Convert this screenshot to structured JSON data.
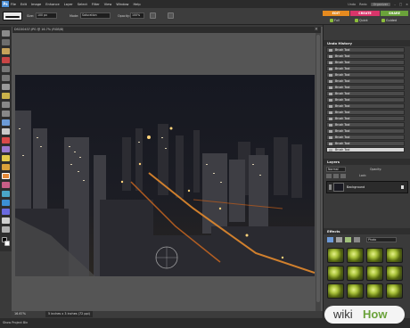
{
  "menubar": {
    "menus": [
      "File",
      "Edit",
      "Image",
      "Enhance",
      "Layer",
      "Select",
      "Filter",
      "View",
      "Window",
      "Help"
    ],
    "right": [
      "Undo",
      "Redo",
      "Organizer"
    ]
  },
  "options": {
    "size_label": "Size:",
    "size_value": "100 px",
    "mode_label": "Mode:",
    "mode_value": "Saturation",
    "opacity_label": "Opacity:",
    "opacity_value": "100%"
  },
  "modes": {
    "edit": "EDIT",
    "create": "CREATE",
    "share": "SHARE",
    "sub": [
      "Full",
      "Quick",
      "Guided"
    ]
  },
  "document": {
    "title": "DSC00437.JPG @ 16.7% (RGB/8)",
    "zoom": "16.67%",
    "dims": "5 inches x 3 inches (72 ppi)"
  },
  "undo_history": {
    "title": "Undo History",
    "items": [
      "Brush Tool",
      "Brush Tool",
      "Brush Tool",
      "Brush Tool",
      "Brush Tool",
      "Brush Tool",
      "Brush Tool",
      "Brush Tool",
      "Brush Tool",
      "Brush Tool",
      "Brush Tool",
      "Brush Tool",
      "Brush Tool",
      "Brush Tool",
      "Brush Tool",
      "Brush Tool",
      "Brush Tool"
    ],
    "selected_index": 16
  },
  "layers": {
    "title": "Layers",
    "blend": "Normal",
    "opacity_label": "Opacity:",
    "lock_label": "Lock:",
    "layer_name": "Background"
  },
  "effects": {
    "title": "Effects",
    "filter": "Photo"
  },
  "projectbin": {
    "label": "Show Project Bin"
  },
  "watermark": {
    "part1": "wiki",
    "part2": "How"
  },
  "colors": {
    "edit_tab": "#e58a1f",
    "create_tab": "#d8356a",
    "share_tab": "#6aa23a",
    "accent": "#4a8fd8"
  }
}
